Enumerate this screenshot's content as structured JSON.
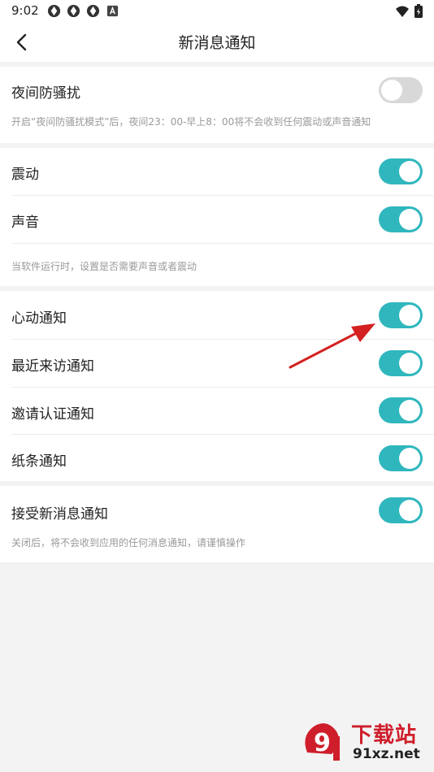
{
  "status_bar": {
    "time": "9:02",
    "icons": [
      "app-icon",
      "app-icon",
      "app-icon",
      "a-letter-icon"
    ],
    "right_icons": [
      "wifi-icon",
      "battery-icon"
    ]
  },
  "app_bar": {
    "back_icon": "chevron-left-icon",
    "title": "新消息通知"
  },
  "sections": {
    "night": {
      "label": "夜间防骚扰",
      "toggle_on": false,
      "hint": "开启“夜间防骚扰模式”后，夜间23：00-早上8：00将不会收到任何震动或声音通知"
    },
    "alerts": {
      "vibrate": {
        "label": "震动",
        "toggle_on": true
      },
      "sound": {
        "label": "声音",
        "toggle_on": true
      },
      "hint": "当软件运行时，设置是否需要声音或者震动"
    },
    "notify": {
      "heart": {
        "label": "心动通知",
        "toggle_on": true
      },
      "visitors": {
        "label": "最近来访通知",
        "toggle_on": true
      },
      "invite": {
        "label": "邀请认证通知",
        "toggle_on": true
      },
      "notes": {
        "label": "纸条通知",
        "toggle_on": true
      }
    },
    "receive": {
      "label": "接受新消息通知",
      "toggle_on": true,
      "hint": "关闭后，将不会收到应用的任何消息通知，请谨慎操作"
    }
  },
  "colors": {
    "toggle_on": "#2fb7bd",
    "toggle_off": "#d8d8d8",
    "annotation_arrow": "#d42020",
    "watermark_red": "#cf1e2b"
  },
  "watermark": {
    "brand": "下载站",
    "logo_mark": "9",
    "url": "91xz.net"
  }
}
